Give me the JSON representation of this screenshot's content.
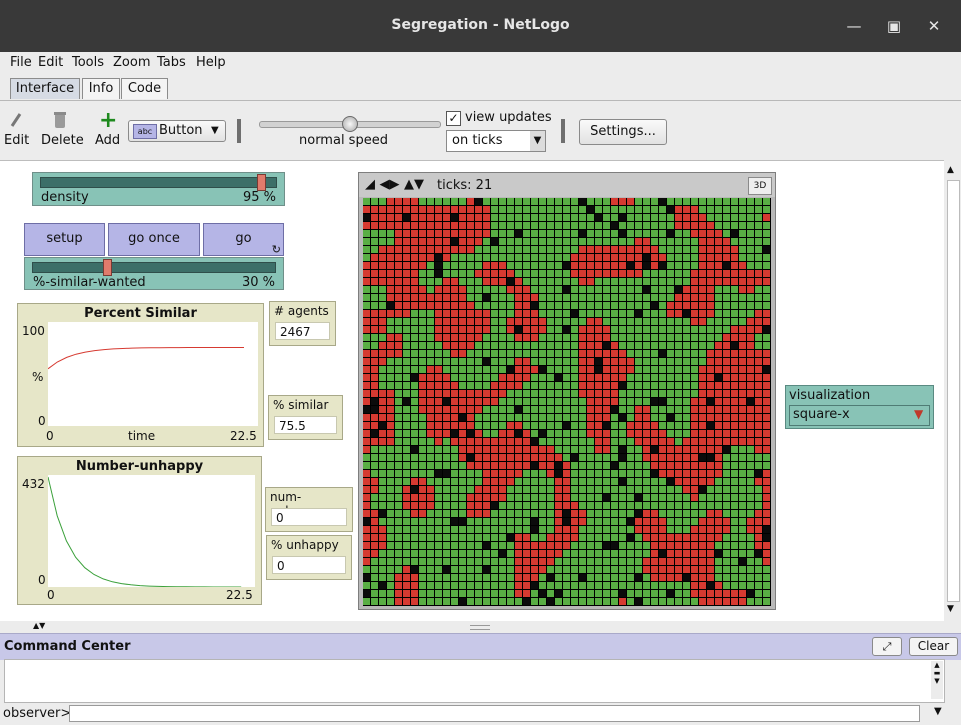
{
  "window": {
    "title": "Segregation - NetLogo"
  },
  "menu": [
    "File",
    "Edit",
    "Tools",
    "Zoom",
    "Tabs",
    "Help"
  ],
  "tabs": [
    "Interface",
    "Info",
    "Code"
  ],
  "toolbar": {
    "edit": "Edit",
    "delete": "Delete",
    "add": "Add",
    "widget_type": "Button",
    "widget_icon_text": "abc",
    "speed_label": "normal speed",
    "speed_level": 0.5,
    "view_updates": "view updates",
    "view_updates_checked": true,
    "update_mode": "on ticks",
    "settings": "Settings..."
  },
  "widgets": {
    "density": {
      "name": "density",
      "value": "95 %",
      "fraction": 0.95
    },
    "setup": "setup",
    "go_once": "go once",
    "go": "go",
    "similar_wanted": {
      "name": "%-similar-wanted",
      "value": "30 %",
      "fraction": 0.3
    },
    "plot_similar": {
      "title": "Percent Similar",
      "ymax": "100",
      "ymin": "0",
      "ylabel": "%",
      "xmin": "0",
      "xlabel": "time",
      "xmax": "22.5"
    },
    "plot_unhappy": {
      "title": "Number-unhappy",
      "ymax": "432",
      "ymin": "0",
      "xmin": "0",
      "xmax": "22.5"
    },
    "mon_agents": {
      "label": "# agents",
      "value": "2467"
    },
    "mon_similar": {
      "label": "% similar",
      "value": "75.5"
    },
    "mon_numunhappy": {
      "label": "num-unhappy",
      "value": "0"
    },
    "mon_pctunhappy": {
      "label": "% unhappy",
      "value": "0"
    },
    "visualization": {
      "label": "visualization",
      "value": "square-x"
    }
  },
  "view": {
    "ticks": "ticks: 21",
    "btn3d": "3D",
    "colors": {
      "red": "#d63a31",
      "green": "#59ae44",
      "black": "#0b0b0b"
    }
  },
  "command_center": {
    "title": "Command Center",
    "clear": "Clear",
    "observer": "observer>"
  }
}
